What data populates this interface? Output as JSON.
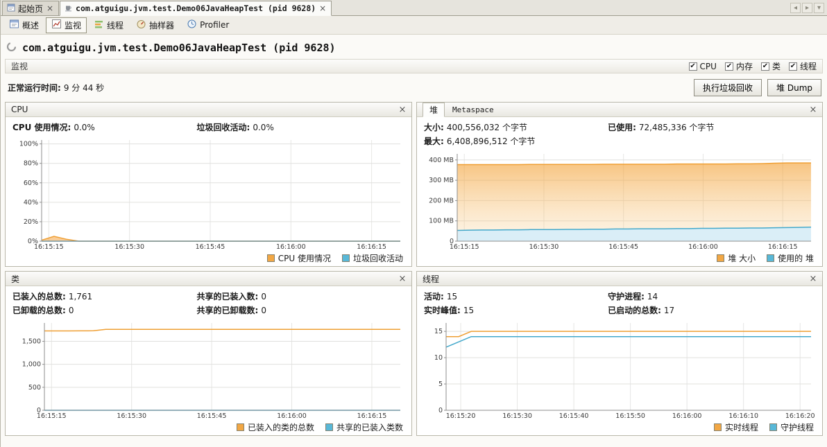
{
  "icons": {
    "close": "×",
    "check": "✔",
    "arrow_left": "◂",
    "arrow_right": "▸",
    "arrow_down": "▾"
  },
  "colors": {
    "orange": "#f2a744",
    "blue": "#58b8d8"
  },
  "tabs": {
    "start": {
      "label": "起始页"
    },
    "app": {
      "label": "com.atguigu.jvm.test.Demo06JavaHeapTest (pid 9628)"
    }
  },
  "toolbar": {
    "items": [
      {
        "label": "概述"
      },
      {
        "label": "监视"
      },
      {
        "label": "线程"
      },
      {
        "label": "抽样器"
      },
      {
        "label": "Profiler"
      }
    ]
  },
  "page": {
    "title": "com.atguigu.jvm.test.Demo06JavaHeapTest (pid 9628)",
    "section_label": "监视",
    "checkboxes": [
      {
        "label": "CPU"
      },
      {
        "label": "内存"
      },
      {
        "label": "类"
      },
      {
        "label": "线程"
      }
    ],
    "uptime_label": "正常运行时间:",
    "uptime_value": "9 分 44 秒",
    "gc_button": "执行垃圾回收",
    "heap_dump_button": "堆 Dump"
  },
  "panels": {
    "cpu": {
      "title": "CPU",
      "stats": [
        {
          "label": "CPU 使用情况:",
          "value": "0.0%"
        },
        {
          "label": "垃圾回收活动:",
          "value": "0.0%"
        }
      ],
      "legend": [
        {
          "label": "CPU 使用情况"
        },
        {
          "label": "垃圾回收活动"
        }
      ]
    },
    "heap": {
      "tab_heap": "堆",
      "tab_metaspace": "Metaspace",
      "stats": [
        {
          "label": "大小:",
          "value": "400,556,032 个字节"
        },
        {
          "label": "已使用:",
          "value": "72,485,336 个字节"
        },
        {
          "label": "最大:",
          "value": "6,408,896,512 个字节"
        }
      ],
      "legend": [
        {
          "label": "堆 大小"
        },
        {
          "label": "使用的 堆"
        }
      ]
    },
    "classes": {
      "title": "类",
      "stats": [
        {
          "label": "已装入的总数:",
          "value": "1,761"
        },
        {
          "label": "共享的已装入数:",
          "value": "0"
        },
        {
          "label": "已卸载的总数:",
          "value": "0"
        },
        {
          "label": "共享的已卸载数:",
          "value": "0"
        }
      ],
      "legend": [
        {
          "label": "已装入的类的总数"
        },
        {
          "label": "共享的已装入类数"
        }
      ]
    },
    "threads": {
      "title": "线程",
      "stats": [
        {
          "label": "活动:",
          "value": "15"
        },
        {
          "label": "守护进程:",
          "value": "14"
        },
        {
          "label": "实时峰值:",
          "value": "15"
        },
        {
          "label": "已启动的总数:",
          "value": "17"
        }
      ],
      "legend": [
        {
          "label": "实时线程"
        },
        {
          "label": "守护线程"
        }
      ]
    }
  },
  "chart_data": {
    "cpu": {
      "id": "cpu",
      "type": "area",
      "padL": 42,
      "ylim": [
        0,
        104
      ],
      "yticks": [
        {
          "v": 0,
          "l": "0%"
        },
        {
          "v": 20,
          "l": "20%"
        },
        {
          "v": 40,
          "l": "40%"
        },
        {
          "v": 60,
          "l": "60%"
        },
        {
          "v": 80,
          "l": "80%"
        },
        {
          "v": 100,
          "l": "100%"
        }
      ],
      "xticks": [
        {
          "f": 0.02,
          "l": "16:15:15"
        },
        {
          "f": 0.245,
          "l": "16:15:30"
        },
        {
          "f": 0.47,
          "l": "16:15:45"
        },
        {
          "f": 0.695,
          "l": "16:16:00"
        },
        {
          "f": 0.92,
          "l": "16:16:15"
        }
      ],
      "series": [
        {
          "name": "CPU 使用情况",
          "color": "#ef9f33",
          "fill": "rgba(245,164,66,0.55)",
          "values": [
            1,
            5,
            2,
            0,
            0,
            0,
            0,
            0,
            0,
            0,
            0,
            0,
            0,
            0,
            0,
            0,
            0,
            0,
            0,
            0,
            0,
            0,
            0,
            0,
            0,
            0,
            0,
            0,
            0,
            0
          ]
        },
        {
          "name": "垃圾回收活动",
          "color": "#41a8cb",
          "values": [
            0,
            0,
            0,
            0,
            0,
            0,
            0,
            0,
            0,
            0,
            0,
            0,
            0,
            0,
            0,
            0,
            0,
            0,
            0,
            0,
            0,
            0,
            0,
            0,
            0,
            0,
            0,
            0,
            0,
            0
          ]
        }
      ]
    },
    "heap": {
      "id": "heap",
      "type": "area",
      "padL": 48,
      "ylim": [
        0,
        430
      ],
      "yticks": [
        {
          "v": 0,
          "l": "0"
        },
        {
          "v": 100,
          "l": "100 MB"
        },
        {
          "v": 200,
          "l": "200 MB"
        },
        {
          "v": 300,
          "l": "300 MB"
        },
        {
          "v": 400,
          "l": "400 MB"
        }
      ],
      "xticks": [
        {
          "f": 0.02,
          "l": "16:15:15"
        },
        {
          "f": 0.245,
          "l": "16:15:30"
        },
        {
          "f": 0.47,
          "l": "16:15:45"
        },
        {
          "f": 0.695,
          "l": "16:16:00"
        },
        {
          "f": 0.92,
          "l": "16:16:15"
        }
      ],
      "series": [
        {
          "name": "堆 大小",
          "color": "#ef9f33",
          "grad": [
            "rgba(243,160,52,0.62)",
            "rgba(248,210,150,0.22)"
          ],
          "values": [
            377,
            377,
            377,
            377,
            377,
            377,
            378,
            378,
            378,
            378,
            378,
            378,
            379,
            379,
            379,
            379,
            379,
            379,
            380,
            380,
            380,
            380,
            380,
            381,
            381,
            382,
            384,
            385,
            385,
            385
          ]
        },
        {
          "name": "使用的 堆",
          "color": "#41a8cb",
          "fill": "#daeef7",
          "values": [
            53,
            54,
            55,
            55,
            56,
            56,
            57,
            57,
            57,
            58,
            58,
            59,
            59,
            60,
            60,
            61,
            61,
            61,
            62,
            62,
            63,
            63,
            64,
            64,
            65,
            65,
            66,
            67,
            68,
            69
          ]
        }
      ]
    },
    "classes": {
      "id": "classes",
      "type": "line",
      "padL": 46,
      "ylim": [
        0,
        1900
      ],
      "yticks": [
        {
          "v": 0,
          "l": "0"
        },
        {
          "v": 500,
          "l": "500"
        },
        {
          "v": 1000,
          "l": "1,000"
        },
        {
          "v": 1500,
          "l": "1,500"
        }
      ],
      "xticks": [
        {
          "f": 0.02,
          "l": "16:15:15"
        },
        {
          "f": 0.245,
          "l": "16:15:30"
        },
        {
          "f": 0.47,
          "l": "16:15:45"
        },
        {
          "f": 0.695,
          "l": "16:16:00"
        },
        {
          "f": 0.92,
          "l": "16:16:15"
        }
      ],
      "series": [
        {
          "name": "已装入的类的总数",
          "color": "#ef9f33",
          "values": [
            1727,
            1727,
            1727,
            1728,
            1730,
            1761,
            1761,
            1761,
            1761,
            1761,
            1761,
            1761,
            1761,
            1761,
            1761,
            1761,
            1761,
            1761,
            1761,
            1761,
            1761,
            1761,
            1761,
            1761,
            1761,
            1761,
            1761,
            1761,
            1761,
            1761
          ]
        },
        {
          "name": "共享的已装入类数",
          "color": "#41a8cb",
          "values": [
            0,
            0,
            0,
            0,
            0,
            0,
            0,
            0,
            0,
            0,
            0,
            0,
            0,
            0,
            0,
            0,
            0,
            0,
            0,
            0,
            0,
            0,
            0,
            0,
            0,
            0,
            0,
            0,
            0,
            0
          ]
        }
      ]
    },
    "threads": {
      "id": "threads",
      "type": "line",
      "padL": 32,
      "ylim": [
        0,
        16.6
      ],
      "yticks": [
        {
          "v": 0,
          "l": "0"
        },
        {
          "v": 5,
          "l": "5"
        },
        {
          "v": 10,
          "l": "10"
        },
        {
          "v": 15,
          "l": "15"
        }
      ],
      "xticks": [
        {
          "f": 0.04,
          "l": "16:15:20"
        },
        {
          "f": 0.195,
          "l": "16:15:30"
        },
        {
          "f": 0.35,
          "l": "16:15:40"
        },
        {
          "f": 0.505,
          "l": "16:15:50"
        },
        {
          "f": 0.66,
          "l": "16:16:00"
        },
        {
          "f": 0.815,
          "l": "16:16:10"
        },
        {
          "f": 0.97,
          "l": "16:16:20"
        }
      ],
      "series": [
        {
          "name": "实时线程",
          "color": "#ef9f33",
          "values": [
            14,
            14,
            15,
            15,
            15,
            15,
            15,
            15,
            15,
            15,
            15,
            15,
            15,
            15,
            15,
            15,
            15,
            15,
            15,
            15,
            15,
            15,
            15,
            15,
            15,
            15,
            15,
            15,
            15,
            15
          ]
        },
        {
          "name": "守护线程",
          "color": "#41a8cb",
          "values": [
            12,
            13,
            14,
            14,
            14,
            14,
            14,
            14,
            14,
            14,
            14,
            14,
            14,
            14,
            14,
            14,
            14,
            14,
            14,
            14,
            14,
            14,
            14,
            14,
            14,
            14,
            14,
            14,
            14,
            14
          ]
        }
      ]
    }
  }
}
